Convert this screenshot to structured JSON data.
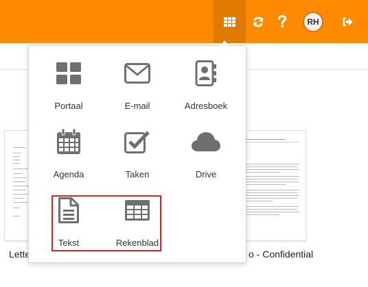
{
  "header": {
    "apps_icon": "grid-icon",
    "refresh_icon": "refresh-icon",
    "help_icon": "help-icon",
    "avatar_initials": "RH",
    "logout_icon": "logout-icon",
    "accent_color": "#ff8a00"
  },
  "launcher": {
    "apps": [
      {
        "label": "Portaal",
        "icon": "portal-icon"
      },
      {
        "label": "E-mail",
        "icon": "mail-icon"
      },
      {
        "label": "Adresboek",
        "icon": "address-book-icon"
      },
      {
        "label": "Agenda",
        "icon": "calendar-icon"
      },
      {
        "label": "Taken",
        "icon": "tasks-icon"
      },
      {
        "label": "Drive",
        "icon": "cloud-icon"
      },
      {
        "label": "Tekst",
        "icon": "text-document-icon"
      },
      {
        "label": "Rekenblad",
        "icon": "spreadsheet-icon"
      }
    ],
    "highlight_color": "#d9232e"
  },
  "background": {
    "left_doc_caption": "Lette",
    "right_doc_caption": "o - Confidential"
  }
}
